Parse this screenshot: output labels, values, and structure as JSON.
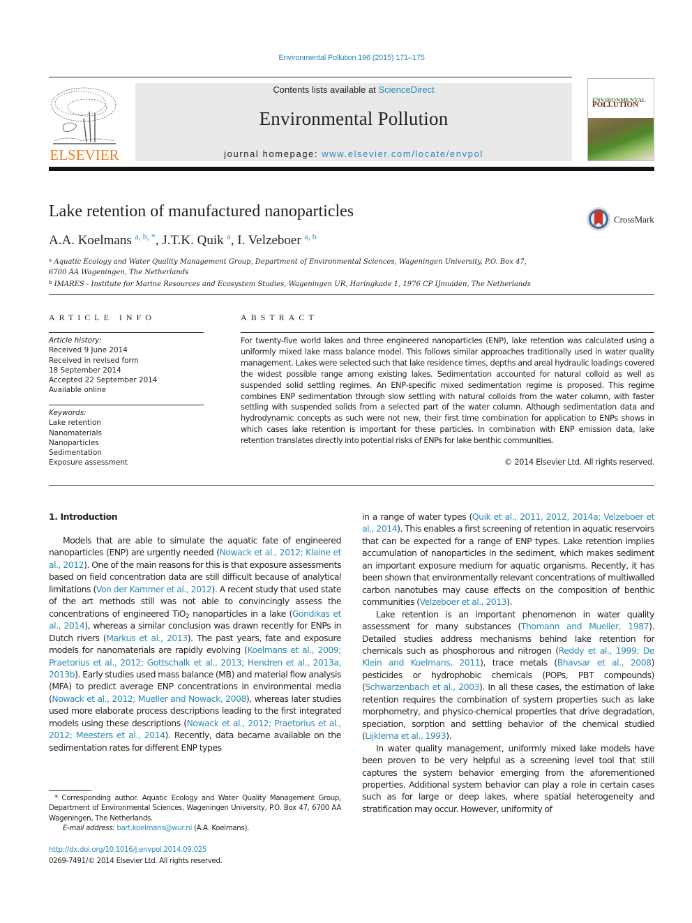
{
  "header": {
    "citation": "Environmental Pollution 196 (2015) 171–175",
    "contents_prefix": "Contents lists available at ",
    "contents_link": "ScienceDirect",
    "journal_name": "Environmental Pollution",
    "homepage_prefix": "journal homepage: ",
    "homepage_link": "www.elsevier.com/locate/envpol",
    "publisher_logo": "ELSEVIER",
    "cover_title_line1": "ENVIRONMENTAL",
    "cover_title_line2": "POLLUTION",
    "brand_color": "#f07b21",
    "link_color": "#2a89b5"
  },
  "article": {
    "title": "Lake retention of manufactured nanoparticles",
    "crossmark_label": "CrossMark",
    "authors": [
      {
        "name": "A.A. Koelmans",
        "marks": "a, b, *",
        "sep": ", "
      },
      {
        "name": "J.T.K. Quik",
        "marks": "a",
        "sep": ", "
      },
      {
        "name": "I. Velzeboer",
        "marks": "a, b",
        "sep": ""
      }
    ],
    "affiliations": [
      {
        "mark": "a",
        "text": "Aquatic Ecology and Water Quality Management Group, Department of Environmental Sciences, Wageningen University, P.O. Box 47, 6700 AA Wageningen, The Netherlands"
      },
      {
        "mark": "b",
        "text": "IMARES - Institute for Marine Resources and Ecosystem Studies, Wageningen UR, Haringkade 1, 1976 CP IJmuiden, The Netherlands"
      }
    ]
  },
  "article_info": {
    "heading": "ARTICLE INFO",
    "history_label": "Article history:",
    "history": [
      "Received 9 June 2014",
      "Received in revised form",
      "18 September 2014",
      "Accepted 22 September 2014",
      "Available online"
    ],
    "keywords_label": "Keywords:",
    "keywords": [
      "Lake retention",
      "Nanomaterials",
      "Nanoparticles",
      "Sedimentation",
      "Exposure assessment"
    ]
  },
  "abstract": {
    "heading": "ABSTRACT",
    "text": "For twenty-five world lakes and three engineered nanoparticles (ENP), lake retention was calculated using a uniformly mixed lake mass balance model. This follows similar approaches traditionally used in water quality management. Lakes were selected such that lake residence times, depths and areal hydraulic loadings covered the widest possible range among existing lakes. Sedimentation accounted for natural colloid as well as suspended solid settling regimes. An ENP-specific mixed sedimentation regime is proposed. This regime combines ENP sedimentation through slow settling with natural colloids from the water column, with faster settling with suspended solids from a selected part of the water column. Although sedimentation data and hydrodynamic concepts as such were not new, their first time combination for application to ENPs shows in which cases lake retention is important for these particles. In combination with ENP emission data, lake retention translates directly into potential risks of ENPs for lake benthic communities.",
    "copyright": "© 2014 Elsevier Ltd. All rights reserved."
  },
  "body": {
    "section_heading": "1.  Introduction",
    "left_paragraph": [
      {
        "t": "Models that are able to simulate the aquatic fate of engineered nanoparticles (ENP) are urgently needed ("
      },
      {
        "link": "Nowack et al., 2012; Klaine et al., 2012"
      },
      {
        "t": "). One of the main reasons for this is that exposure assessments based on field concentration data are still difficult because of analytical limitations ("
      },
      {
        "link": "Von der Kammer et al., 2012"
      },
      {
        "t": "). A recent study that used state of the art methods still was not able to convincingly assess the concentrations of engineered TiO"
      },
      {
        "sub": "2"
      },
      {
        "t": " nanoparticles in a lake ("
      },
      {
        "link": "Gondikas et al., 2014"
      },
      {
        "t": "), whereas a similar conclusion was drawn recently for ENPs in Dutch rivers ("
      },
      {
        "link": "Markus et al., 2013"
      },
      {
        "t": "). The past years, fate and exposure models for nanomaterials are rapidly evolving ("
      },
      {
        "link": "Koelmans et al., 2009; Praetorius et al., 2012; Gottschalk et al., 2013; Hendren et al., 2013a, 2013b"
      },
      {
        "t": "). Early studies used mass balance (MB) and material flow analysis (MFA) to predict average ENP concentrations in environmental media ("
      },
      {
        "link": "Nowack et al., 2012; Mueller and Nowack, 2008"
      },
      {
        "t": "), whereas later studies used more elaborate process descriptions leading to the first integrated models using these descriptions ("
      },
      {
        "link": "Nowack et al., 2012; Praetorius et al., 2012; Meesters et al., 2014"
      },
      {
        "t": "). Recently, data became available on the sedimentation rates for different ENP types"
      }
    ],
    "right_paragraphs": [
      {
        "indent": false,
        "parts": [
          {
            "t": "in a range of water types ("
          },
          {
            "link": "Quik et al., 2011, 2012, 2014a; Velzeboer et al., 2014"
          },
          {
            "t": "). This enables a first screening of retention in aquatic reservoirs that can be expected for a range of ENP types. Lake retention implies accumulation of nanoparticles in the sediment, which makes sediment an important exposure medium for aquatic organisms. Recently, it has been shown that environmentally relevant concentrations of multiwalled carbon nanotubes may cause effects on the composition of benthic communities ("
          },
          {
            "link": "Velzeboer et al., 2013"
          },
          {
            "t": ")."
          }
        ]
      },
      {
        "indent": true,
        "parts": [
          {
            "t": "Lake retention is an important phenomenon in water quality assessment for many substances ("
          },
          {
            "link": "Thomann and Mueller, 1987"
          },
          {
            "t": "). Detailed studies address mechanisms behind lake retention for chemicals such as phosphorous and nitrogen ("
          },
          {
            "link": "Reddy et al., 1999; De Klein and Koelmans, 2011"
          },
          {
            "t": "), trace metals ("
          },
          {
            "link": "Bhavsar et al., 2008"
          },
          {
            "t": ") pesticides or hydrophobic chemicals (POPs, PBT compounds) ("
          },
          {
            "link": "Schwarzenbach et al., 2003"
          },
          {
            "t": "). In all these cases, the estimation of lake retention requires the combination of system properties such as lake morphometry, and physico-chemical properties that drive degradation, speciation, sorption and settling behavior of the chemical studied ("
          },
          {
            "link": "Lijklema et al., 1993"
          },
          {
            "t": ")."
          }
        ]
      },
      {
        "indent": true,
        "parts": [
          {
            "t": "In water quality management, uniformly mixed lake models have been proven to be very helpful as a screening level tool that still captures the system behavior emerging from the aforementioned properties. Additional system behavior can play a role in certain cases such as for large or deep lakes, where spatial heterogeneity and stratification may occur. However, uniformity of"
          }
        ]
      }
    ]
  },
  "footnote": {
    "corresponding": "* Corresponding author. Aquatic Ecology and Water Quality Management Group, Department of Environmental Sciences, Wageningen University, P.O. Box 47, 6700 AA Wageningen, The Netherlands.",
    "email_label": "E-mail address: ",
    "email": "bart.koelmans@wur.nl",
    "email_suffix": " (A.A. Koelmans).",
    "doi": "http://dx.doi.org/10.1016/j.envpol.2014.09.025",
    "issn_line": "0269-7491/© 2014 Elsevier Ltd. All rights reserved."
  }
}
